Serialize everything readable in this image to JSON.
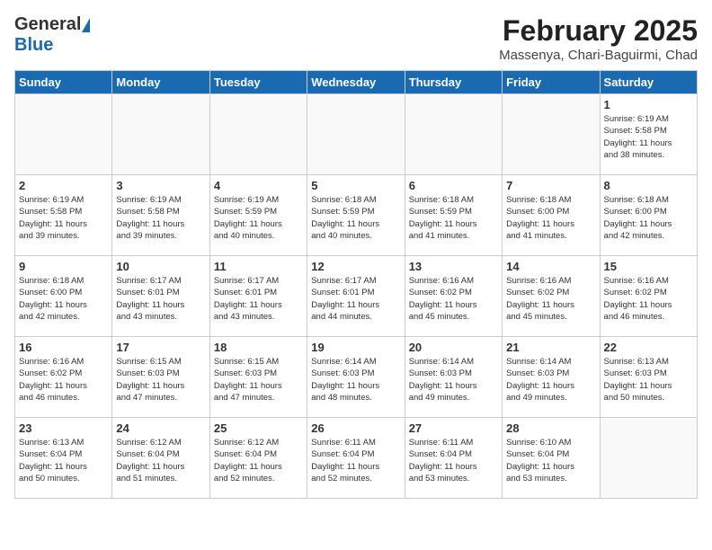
{
  "header": {
    "logo_general": "General",
    "logo_blue": "Blue",
    "title": "February 2025",
    "subtitle": "Massenya, Chari-Baguirmi, Chad"
  },
  "days_of_week": [
    "Sunday",
    "Monday",
    "Tuesday",
    "Wednesday",
    "Thursday",
    "Friday",
    "Saturday"
  ],
  "weeks": [
    [
      {
        "day": "",
        "info": ""
      },
      {
        "day": "",
        "info": ""
      },
      {
        "day": "",
        "info": ""
      },
      {
        "day": "",
        "info": ""
      },
      {
        "day": "",
        "info": ""
      },
      {
        "day": "",
        "info": ""
      },
      {
        "day": "1",
        "info": "Sunrise: 6:19 AM\nSunset: 5:58 PM\nDaylight: 11 hours\nand 38 minutes."
      }
    ],
    [
      {
        "day": "2",
        "info": "Sunrise: 6:19 AM\nSunset: 5:58 PM\nDaylight: 11 hours\nand 39 minutes."
      },
      {
        "day": "3",
        "info": "Sunrise: 6:19 AM\nSunset: 5:58 PM\nDaylight: 11 hours\nand 39 minutes."
      },
      {
        "day": "4",
        "info": "Sunrise: 6:19 AM\nSunset: 5:59 PM\nDaylight: 11 hours\nand 40 minutes."
      },
      {
        "day": "5",
        "info": "Sunrise: 6:18 AM\nSunset: 5:59 PM\nDaylight: 11 hours\nand 40 minutes."
      },
      {
        "day": "6",
        "info": "Sunrise: 6:18 AM\nSunset: 5:59 PM\nDaylight: 11 hours\nand 41 minutes."
      },
      {
        "day": "7",
        "info": "Sunrise: 6:18 AM\nSunset: 6:00 PM\nDaylight: 11 hours\nand 41 minutes."
      },
      {
        "day": "8",
        "info": "Sunrise: 6:18 AM\nSunset: 6:00 PM\nDaylight: 11 hours\nand 42 minutes."
      }
    ],
    [
      {
        "day": "9",
        "info": "Sunrise: 6:18 AM\nSunset: 6:00 PM\nDaylight: 11 hours\nand 42 minutes."
      },
      {
        "day": "10",
        "info": "Sunrise: 6:17 AM\nSunset: 6:01 PM\nDaylight: 11 hours\nand 43 minutes."
      },
      {
        "day": "11",
        "info": "Sunrise: 6:17 AM\nSunset: 6:01 PM\nDaylight: 11 hours\nand 43 minutes."
      },
      {
        "day": "12",
        "info": "Sunrise: 6:17 AM\nSunset: 6:01 PM\nDaylight: 11 hours\nand 44 minutes."
      },
      {
        "day": "13",
        "info": "Sunrise: 6:16 AM\nSunset: 6:02 PM\nDaylight: 11 hours\nand 45 minutes."
      },
      {
        "day": "14",
        "info": "Sunrise: 6:16 AM\nSunset: 6:02 PM\nDaylight: 11 hours\nand 45 minutes."
      },
      {
        "day": "15",
        "info": "Sunrise: 6:16 AM\nSunset: 6:02 PM\nDaylight: 11 hours\nand 46 minutes."
      }
    ],
    [
      {
        "day": "16",
        "info": "Sunrise: 6:16 AM\nSunset: 6:02 PM\nDaylight: 11 hours\nand 46 minutes."
      },
      {
        "day": "17",
        "info": "Sunrise: 6:15 AM\nSunset: 6:03 PM\nDaylight: 11 hours\nand 47 minutes."
      },
      {
        "day": "18",
        "info": "Sunrise: 6:15 AM\nSunset: 6:03 PM\nDaylight: 11 hours\nand 47 minutes."
      },
      {
        "day": "19",
        "info": "Sunrise: 6:14 AM\nSunset: 6:03 PM\nDaylight: 11 hours\nand 48 minutes."
      },
      {
        "day": "20",
        "info": "Sunrise: 6:14 AM\nSunset: 6:03 PM\nDaylight: 11 hours\nand 49 minutes."
      },
      {
        "day": "21",
        "info": "Sunrise: 6:14 AM\nSunset: 6:03 PM\nDaylight: 11 hours\nand 49 minutes."
      },
      {
        "day": "22",
        "info": "Sunrise: 6:13 AM\nSunset: 6:03 PM\nDaylight: 11 hours\nand 50 minutes."
      }
    ],
    [
      {
        "day": "23",
        "info": "Sunrise: 6:13 AM\nSunset: 6:04 PM\nDaylight: 11 hours\nand 50 minutes."
      },
      {
        "day": "24",
        "info": "Sunrise: 6:12 AM\nSunset: 6:04 PM\nDaylight: 11 hours\nand 51 minutes."
      },
      {
        "day": "25",
        "info": "Sunrise: 6:12 AM\nSunset: 6:04 PM\nDaylight: 11 hours\nand 52 minutes."
      },
      {
        "day": "26",
        "info": "Sunrise: 6:11 AM\nSunset: 6:04 PM\nDaylight: 11 hours\nand 52 minutes."
      },
      {
        "day": "27",
        "info": "Sunrise: 6:11 AM\nSunset: 6:04 PM\nDaylight: 11 hours\nand 53 minutes."
      },
      {
        "day": "28",
        "info": "Sunrise: 6:10 AM\nSunset: 6:04 PM\nDaylight: 11 hours\nand 53 minutes."
      },
      {
        "day": "",
        "info": ""
      }
    ]
  ]
}
